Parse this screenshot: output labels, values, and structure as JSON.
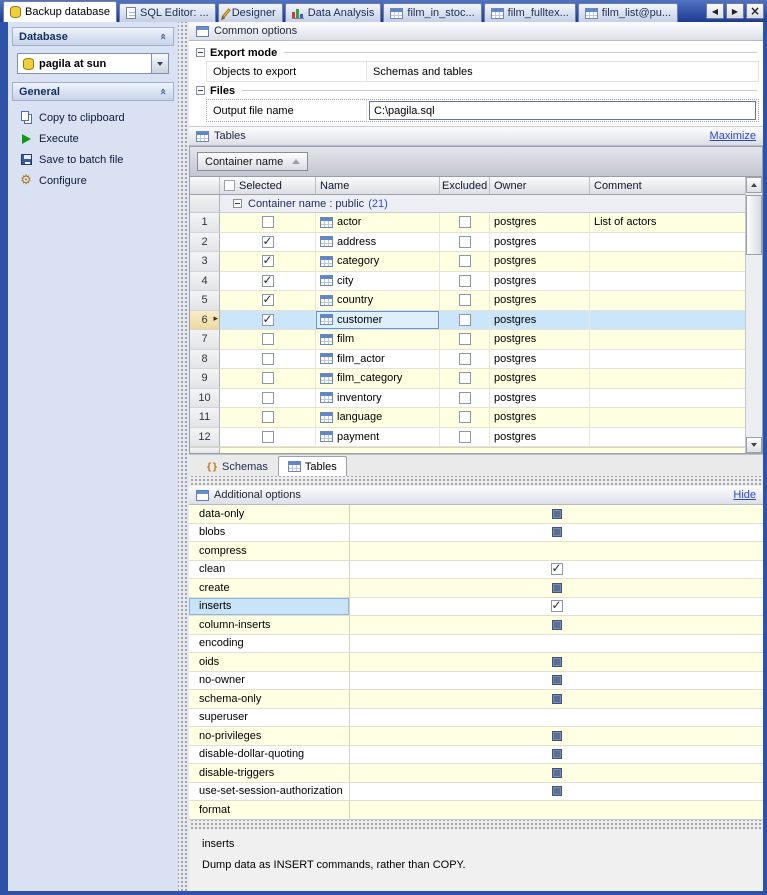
{
  "tabbar": {
    "tabs": [
      {
        "label": "Backup database",
        "icon": "database-icon",
        "active": true
      },
      {
        "label": "SQL Editor: ...",
        "icon": "sql-doc-icon",
        "active": false
      },
      {
        "label": "Designer",
        "icon": "pencil-icon",
        "active": false
      },
      {
        "label": "Data Analysis",
        "icon": "chart-icon",
        "active": false
      },
      {
        "label": "film_in_stoc...",
        "icon": "view-icon",
        "active": false
      },
      {
        "label": "film_fulltex...",
        "icon": "view-icon",
        "active": false
      },
      {
        "label": "film_list@pu...",
        "icon": "view-icon",
        "active": false
      }
    ]
  },
  "sidebar": {
    "sections": [
      {
        "title": "Database"
      },
      {
        "title": "General"
      }
    ],
    "database_combo": {
      "value": "pagila at sun"
    },
    "actions": [
      {
        "label": "Copy to clipboard",
        "icon": "copy-icon"
      },
      {
        "label": "Execute",
        "icon": "execute-icon"
      },
      {
        "label": "Save to batch file",
        "icon": "save-icon"
      },
      {
        "label": "Configure",
        "icon": "configure-icon"
      }
    ]
  },
  "common_options": {
    "title": "Common options",
    "export_mode": {
      "title": "Export mode",
      "rows": [
        {
          "label": "Objects to export",
          "value": "Schemas and tables"
        }
      ]
    },
    "files": {
      "title": "Files",
      "rows": [
        {
          "label": "Output file name",
          "value": "C:\\pagila.sql"
        }
      ]
    }
  },
  "tables_panel": {
    "title": "Tables",
    "maximize_link": "Maximize",
    "group_by_button": "Container name",
    "columns": {
      "selected": "Selected",
      "name": "Name",
      "excluded": "Excluded",
      "owner": "Owner",
      "comment": "Comment"
    },
    "group_row": {
      "label": "Container name : public",
      "count": "(21)"
    },
    "rows": [
      {
        "num": "1",
        "selected": false,
        "name": "actor",
        "excluded": false,
        "owner": "postgres",
        "comment": "List of actors"
      },
      {
        "num": "2",
        "selected": true,
        "name": "address",
        "excluded": false,
        "owner": "postgres",
        "comment": ""
      },
      {
        "num": "3",
        "selected": true,
        "name": "category",
        "excluded": false,
        "owner": "postgres",
        "comment": ""
      },
      {
        "num": "4",
        "selected": true,
        "name": "city",
        "excluded": false,
        "owner": "postgres",
        "comment": ""
      },
      {
        "num": "5",
        "selected": true,
        "name": "country",
        "excluded": false,
        "owner": "postgres",
        "comment": ""
      },
      {
        "num": "6",
        "selected": true,
        "name": "customer",
        "excluded": false,
        "owner": "postgres",
        "comment": "",
        "current": true
      },
      {
        "num": "7",
        "selected": false,
        "name": "film",
        "excluded": false,
        "owner": "postgres",
        "comment": ""
      },
      {
        "num": "8",
        "selected": false,
        "name": "film_actor",
        "excluded": false,
        "owner": "postgres",
        "comment": ""
      },
      {
        "num": "9",
        "selected": false,
        "name": "film_category",
        "excluded": false,
        "owner": "postgres",
        "comment": ""
      },
      {
        "num": "10",
        "selected": false,
        "name": "inventory",
        "excluded": false,
        "owner": "postgres",
        "comment": ""
      },
      {
        "num": "11",
        "selected": false,
        "name": "language",
        "excluded": false,
        "owner": "postgres",
        "comment": ""
      },
      {
        "num": "12",
        "selected": false,
        "name": "payment",
        "excluded": false,
        "owner": "postgres",
        "comment": ""
      }
    ],
    "bottom_tabs": [
      {
        "label": "Schemas",
        "icon": "schemas-icon",
        "active": false
      },
      {
        "label": "Tables",
        "icon": "tables-tab-icon",
        "active": true
      }
    ]
  },
  "additional_options": {
    "title": "Additional options",
    "hide_link": "Hide",
    "options": [
      {
        "label": "data-only",
        "box": "filled"
      },
      {
        "label": "blobs",
        "box": "filled"
      },
      {
        "label": "compress",
        "box": "none"
      },
      {
        "label": "clean",
        "box": "checked"
      },
      {
        "label": "create",
        "box": "filled"
      },
      {
        "label": "inserts",
        "box": "checked",
        "current": true
      },
      {
        "label": "column-inserts",
        "box": "filled"
      },
      {
        "label": "encoding",
        "box": "none"
      },
      {
        "label": "oids",
        "box": "filled"
      },
      {
        "label": "no-owner",
        "box": "filled"
      },
      {
        "label": "schema-only",
        "box": "filled"
      },
      {
        "label": "superuser",
        "box": "none"
      },
      {
        "label": "no-privileges",
        "box": "filled"
      },
      {
        "label": "disable-dollar-quoting",
        "box": "filled"
      },
      {
        "label": "disable-triggers",
        "box": "filled"
      },
      {
        "label": "use-set-session-authorization",
        "box": "filled"
      },
      {
        "label": "format",
        "box": "none"
      }
    ]
  },
  "description_panel": {
    "title": "inserts",
    "text": "Dump data as INSERT commands, rather than COPY."
  }
}
